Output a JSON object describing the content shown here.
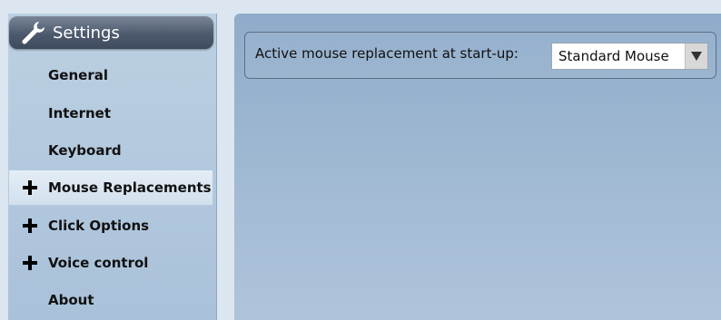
{
  "sidebar": {
    "header": {
      "title": "Settings",
      "icon": "wrench-icon"
    },
    "items": [
      {
        "label": "General",
        "expandable": false
      },
      {
        "label": "Internet",
        "expandable": false
      },
      {
        "label": "Keyboard",
        "expandable": false
      },
      {
        "label": "Mouse Replacements",
        "expandable": true,
        "active": true
      },
      {
        "label": "Click Options",
        "expandable": true
      },
      {
        "label": "Voice control",
        "expandable": true
      },
      {
        "label": "About",
        "expandable": false
      }
    ]
  },
  "main": {
    "startup_label": "Active mouse replacement at start-up:",
    "startup_select": {
      "value": "Standard Mouse",
      "icon": "dropdown-arrow-icon"
    }
  }
}
